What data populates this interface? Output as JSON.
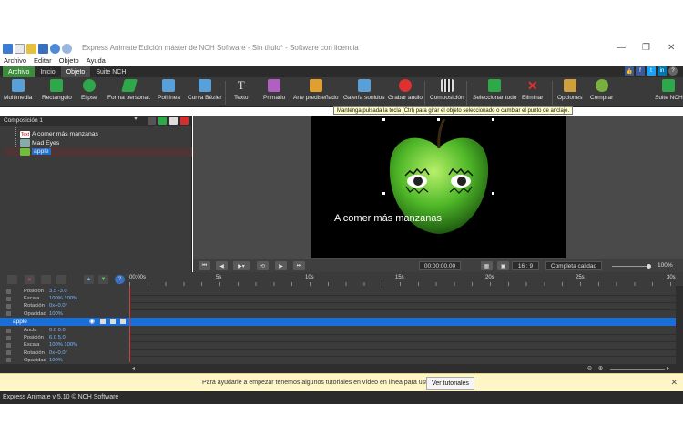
{
  "window": {
    "title": "Express Animate Edición máster de NCH Software - Sin título* - Software con licencia",
    "controls": [
      "—",
      "❐",
      "✕"
    ]
  },
  "menu": [
    "Archivo",
    "Editar",
    "Objeto",
    "Ayuda"
  ],
  "ribbon_tabs": [
    "Archivo",
    "Inicio",
    "Objeto",
    "Suite NCH"
  ],
  "toolbar": [
    {
      "label": "Multimedia",
      "icon": "multimedia-icon",
      "color": "#5aa0d8"
    },
    {
      "label": "Rectángulo",
      "icon": "rectangle-icon",
      "color": "#2fa84a"
    },
    {
      "label": "Elipse",
      "icon": "ellipse-icon",
      "color": "#2fa84a"
    },
    {
      "label": "Forma personal.",
      "icon": "custom-shape-icon",
      "color": "#2fa84a"
    },
    {
      "label": "Polilínea",
      "icon": "polyline-icon",
      "color": "#5aa0d8"
    },
    {
      "label": "Curva Bézier",
      "icon": "bezier-icon",
      "color": "#5aa0d8"
    },
    {
      "label": "Texto",
      "icon": "text-icon",
      "color": "#dddddd"
    },
    {
      "label": "Primario",
      "icon": "primitive-icon",
      "color": "#b060c0"
    },
    {
      "label": "Arte prediseñado",
      "icon": "clipart-icon",
      "color": "#e0a030"
    },
    {
      "label": "Galería sonidos",
      "icon": "sound-gallery-icon",
      "color": "#5aa0d8"
    },
    {
      "label": "Grabar audio",
      "icon": "record-audio-icon",
      "color": "#e03030"
    },
    {
      "label": "Composición",
      "icon": "composition-icon",
      "color": "#dddddd"
    },
    {
      "label": "Seleccionar todo",
      "icon": "select-all-icon",
      "color": "#2fa84a"
    },
    {
      "label": "Eliminar",
      "icon": "delete-icon",
      "color": "#e03030"
    },
    {
      "label": "Opciones",
      "icon": "options-icon",
      "color": "#d0a040"
    },
    {
      "label": "Comprar",
      "icon": "buy-icon",
      "color": "#7ab040"
    },
    {
      "label": "Suite NCH",
      "icon": "nch-suite-icon",
      "color": "#2fa84a"
    }
  ],
  "tooltip": "Mantenga pulsada la tecla (Ctrl) para girar el objeto seleccionado o cambiar el punto de anclaje.",
  "scene": {
    "composition": "Composición 1",
    "items": [
      {
        "label": "A comer más manzanas",
        "icon": "text-layer-icon"
      },
      {
        "label": "Mad Eyes",
        "icon": "image-layer-icon"
      },
      {
        "label": "apple",
        "icon": "apple-layer-icon",
        "selected": true
      }
    ]
  },
  "preview": {
    "caption": "A comer más manzanas",
    "timecode": "00:00:00.00",
    "aspect": "16 : 9",
    "quality": "Completa calidad",
    "zoom": "100%",
    "zoom_fraction": 1.0
  },
  "timeline": {
    "ruler": [
      "00:00s",
      "5s",
      "10s",
      "15s",
      "20s",
      "25s",
      "30s"
    ],
    "top_props": [
      {
        "name": "Posición",
        "value": "3.5    -3.0"
      },
      {
        "name": "Escala",
        "value": "100%  100%"
      },
      {
        "name": "Rotación",
        "value": "0x+0.0°"
      },
      {
        "name": "Opacidad",
        "value": "100%"
      }
    ],
    "selected_layer": "apple",
    "layer_props": [
      {
        "name": "Ancla",
        "value": "0.0    0.0"
      },
      {
        "name": "Posición",
        "value": "6.0    5.0"
      },
      {
        "name": "Escala",
        "value": "100%  100%"
      },
      {
        "name": "Rotación",
        "value": "0x+0.0°"
      },
      {
        "name": "Opacidad",
        "value": "100%"
      }
    ]
  },
  "banner": {
    "text": "Para ayudarle a empezar tenemos algunos tutoriales en vídeo en línea para usted",
    "button": "Ver tutoriales"
  },
  "status": "Express Animate v 5.10 © NCH Software",
  "colors": {
    "accent_green": "#3d8c3d",
    "selection_blue": "#1a6fd6",
    "playhead": "#d04040"
  }
}
